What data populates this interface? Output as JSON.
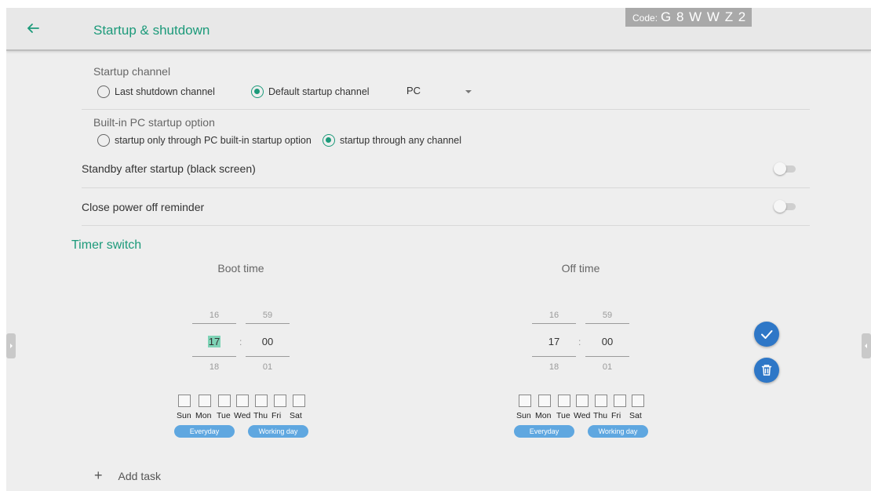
{
  "header": {
    "back_icon": "arrow-left-icon",
    "title": "Startup & shutdown",
    "code_label": "Code:",
    "code_value": "G 8 W W Z 2"
  },
  "startup_channel": {
    "label": "Startup channel",
    "options": [
      "Last shutdown channel",
      "Default startup channel"
    ],
    "selected": "Default startup channel",
    "default_channel": "PC"
  },
  "builtin_pc": {
    "label": "Built-in PC startup option",
    "options": [
      "startup only through PC built-in startup option",
      "startup through any channel"
    ],
    "selected": "startup through any channel"
  },
  "standby": {
    "label": "Standby after startup (black screen)",
    "enabled": false
  },
  "power_off_reminder": {
    "label": "Close power off reminder",
    "enabled": false
  },
  "timer": {
    "title": "Timer switch",
    "boot": {
      "title": "Boot time",
      "hour_prev": "16",
      "hour": "17",
      "hour_next": "18",
      "min_prev": "59",
      "min": "00",
      "min_next": "01",
      "colon": ":"
    },
    "off": {
      "title": "Off time",
      "hour_prev": "16",
      "hour": "17",
      "hour_next": "18",
      "min_prev": "59",
      "min": "00",
      "min_next": "01",
      "colon": ":"
    },
    "days": [
      "Sun",
      "Mon",
      "Tue",
      "Wed",
      "Thu",
      "Fri",
      "Sat"
    ],
    "everyday_label": "Everyday",
    "working_day_label": "Working day"
  },
  "actions": {
    "confirm_icon": "check-icon",
    "delete_icon": "trash-icon"
  },
  "add_task": {
    "plus": "+",
    "label": "Add task"
  },
  "colors": {
    "accent": "#1c9a7a",
    "header_bg": "#e8e8e8",
    "panel_bg": "#eeeeee",
    "button_blue": "#2e77c7",
    "pill_blue": "#5fa7e0"
  }
}
